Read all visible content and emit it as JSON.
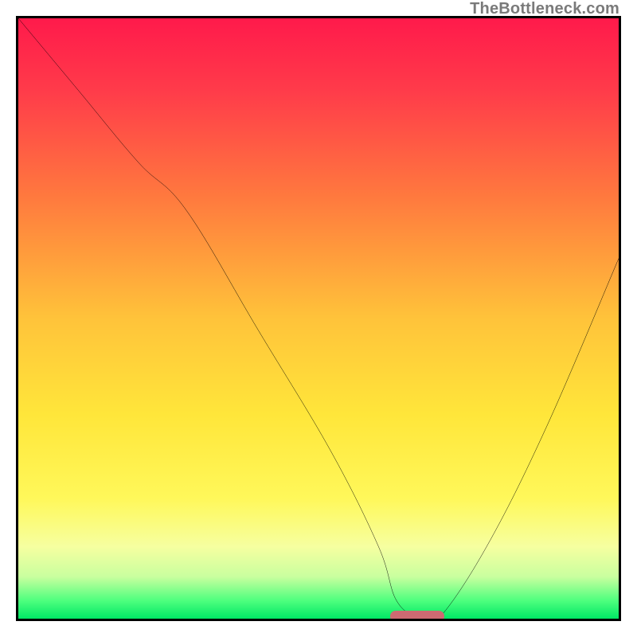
{
  "watermark": "TheBottleneck.com",
  "chart_data": {
    "type": "line",
    "title": "",
    "xlabel": "",
    "ylabel": "",
    "xlim": [
      0,
      100
    ],
    "ylim": [
      0,
      100
    ],
    "grid": false,
    "background_gradient": {
      "stops": [
        {
          "pct": 0,
          "color": "#ff1a4b"
        },
        {
          "pct": 12,
          "color": "#ff3b4a"
        },
        {
          "pct": 30,
          "color": "#ff7a3e"
        },
        {
          "pct": 50,
          "color": "#ffc33a"
        },
        {
          "pct": 66,
          "color": "#ffe63a"
        },
        {
          "pct": 80,
          "color": "#fff85a"
        },
        {
          "pct": 88,
          "color": "#f6ffa0"
        },
        {
          "pct": 93,
          "color": "#c9ff9f"
        },
        {
          "pct": 97,
          "color": "#4eff7e"
        },
        {
          "pct": 100,
          "color": "#00e765"
        }
      ]
    },
    "series": [
      {
        "name": "bottleneck-curve",
        "color": "#000000",
        "x": [
          0,
          10,
          20,
          28,
          40,
          52,
          60,
          63,
          67,
          70,
          78,
          88,
          100
        ],
        "values": [
          100,
          88,
          76,
          68,
          48,
          28,
          12,
          3,
          0,
          0,
          12,
          32,
          60
        ]
      }
    ],
    "annotations": [
      {
        "name": "optimal-marker",
        "type": "bar",
        "color": "#cd6a72",
        "x_start": 62,
        "x_end": 71,
        "y": 0
      }
    ]
  }
}
